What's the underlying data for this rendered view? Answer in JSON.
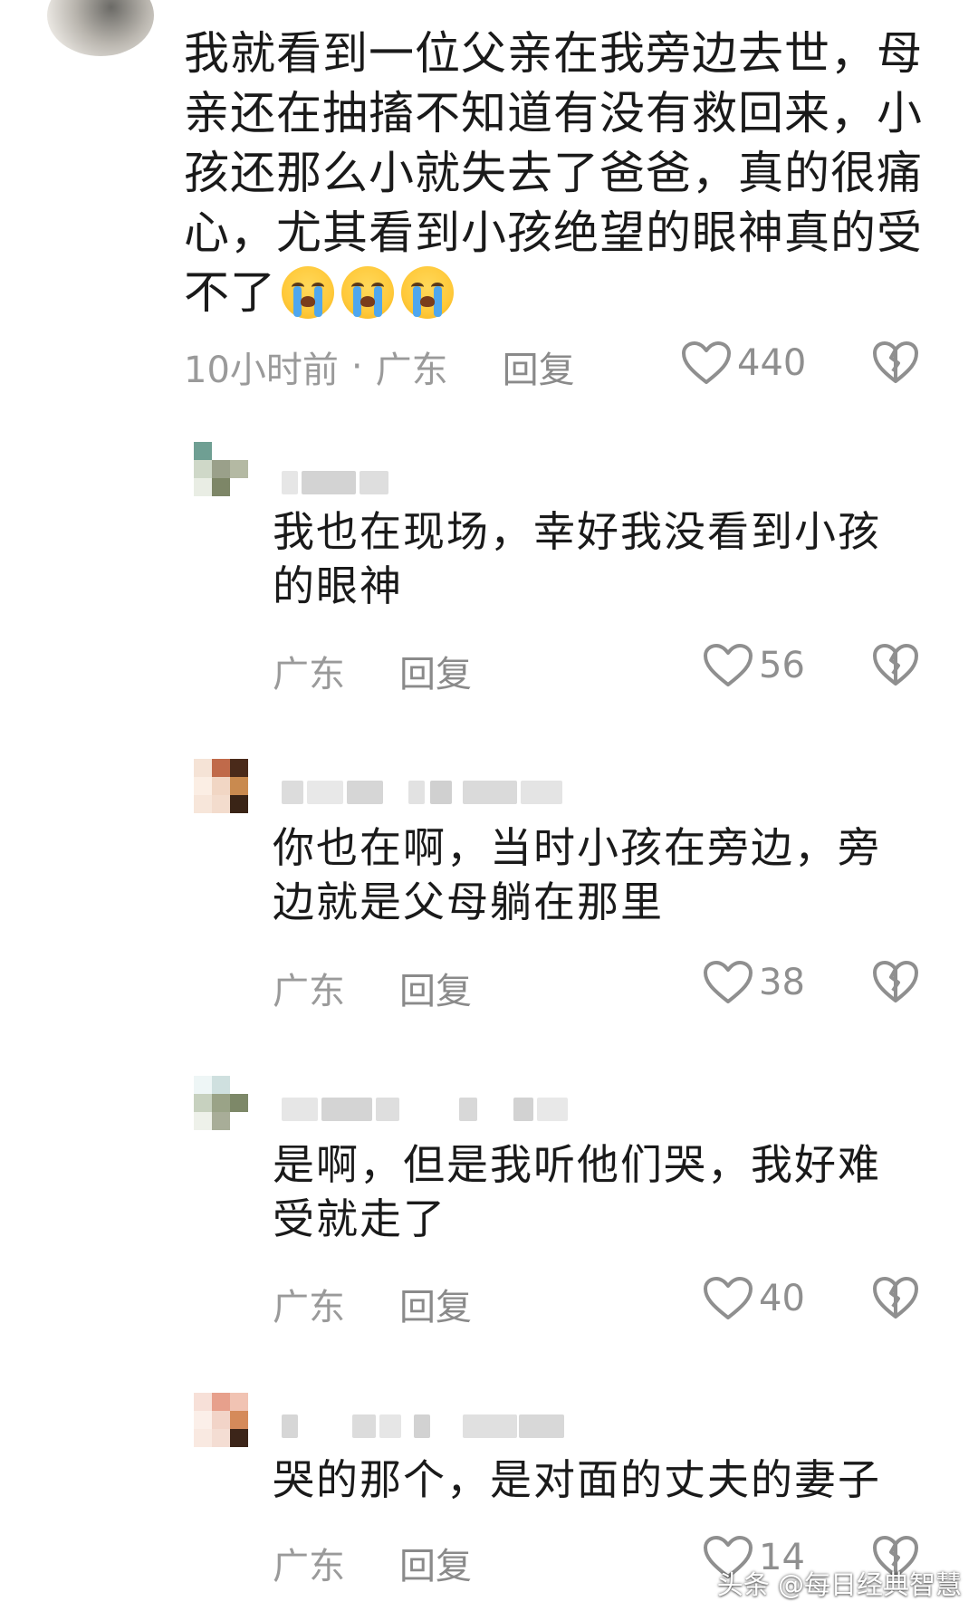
{
  "top_comment": {
    "text": "我就看到一位父亲在我旁边去世，母\n亲还在抽搐不知道有没有救回来，小\n孩还那么小就失去了爸爸，真的很痛\n心，尤其看到小孩绝望的眼神真的受\n不了",
    "emoji": [
      "loudly-crying-face",
      "loudly-crying-face",
      "loudly-crying-face"
    ],
    "time": "10小时前",
    "separator": "·",
    "location": "广东",
    "reply_label": "回复",
    "likes": "440"
  },
  "replies": [
    {
      "text": "我也在现场，幸好我没看到小孩\n的眼神",
      "location": "广东",
      "reply_label": "回复",
      "likes": "56"
    },
    {
      "text": "你也在啊，当时小孩在旁边，旁\n边就是父母躺在那里",
      "location": "广东",
      "reply_label": "回复",
      "likes": "38"
    },
    {
      "text": "是啊，但是我听他们哭，我好难\n受就走了",
      "location": "广东",
      "reply_label": "回复",
      "likes": "40"
    },
    {
      "text": "哭的那个，是对面的丈夫的妻子",
      "location": "广东",
      "reply_label": "回复",
      "likes": "14"
    }
  ],
  "watermark": "头条 @每日经典智慧",
  "colors": {
    "text": "#1a1a1a",
    "meta": "#9a9a9a",
    "icon": "#8f8f8f"
  }
}
